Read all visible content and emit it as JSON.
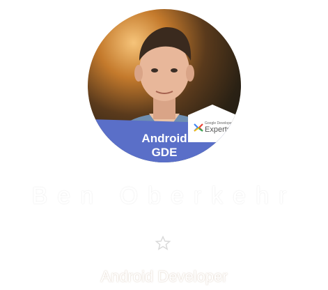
{
  "profile": {
    "name": "Ben Oberkehr",
    "role": "Android Developer",
    "badge_line1": "Android",
    "badge_line2": "GDE",
    "experts_small": "Google Developers",
    "experts_big": "Experts"
  },
  "icons": {
    "rating": "star-outline-icon",
    "program_logo": "gde-logo-icon"
  },
  "colors": {
    "badge_band": "#5a6fc8",
    "background": "#ffffff"
  }
}
